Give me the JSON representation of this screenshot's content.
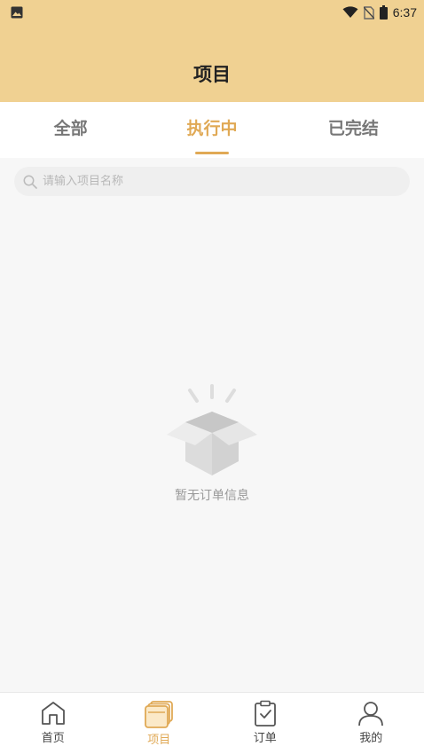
{
  "status_bar": {
    "time": "6:37"
  },
  "header": {
    "title": "项目"
  },
  "tabs": [
    {
      "label": "全部",
      "active": false
    },
    {
      "label": "执行中",
      "active": true
    },
    {
      "label": "已完结",
      "active": false
    }
  ],
  "search": {
    "placeholder": "请输入项目名称",
    "value": ""
  },
  "empty_state": {
    "icon": "empty-box-icon",
    "message": "暂无订单信息"
  },
  "bottom_nav": [
    {
      "label": "首页",
      "icon": "home-icon",
      "active": false
    },
    {
      "label": "项目",
      "icon": "project-icon",
      "active": true
    },
    {
      "label": "订单",
      "icon": "clipboard-check-icon",
      "active": false
    },
    {
      "label": "我的",
      "icon": "user-icon",
      "active": false
    }
  ],
  "colors": {
    "header_bg": "#f0d192",
    "accent": "#e0a955"
  }
}
